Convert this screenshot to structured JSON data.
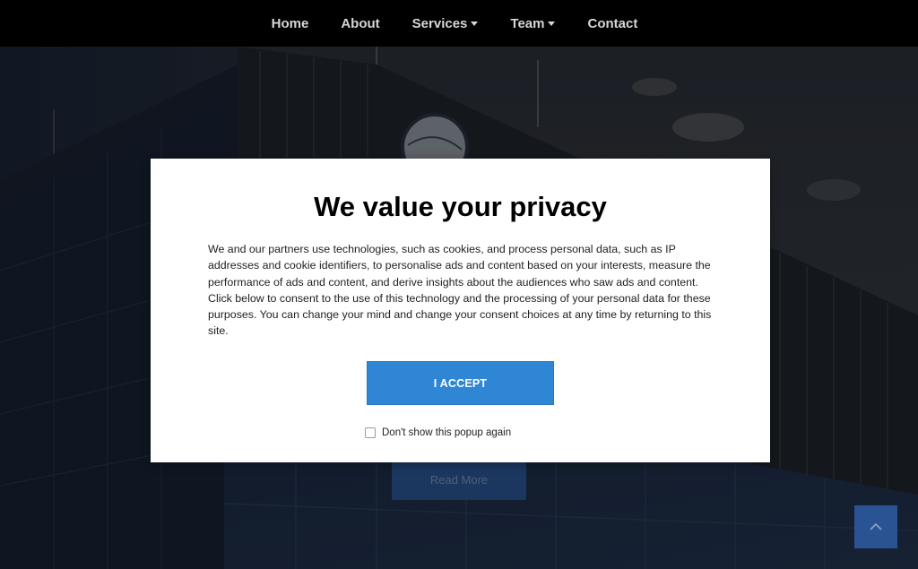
{
  "nav": {
    "items": [
      {
        "label": "Home",
        "has_dropdown": false
      },
      {
        "label": "About",
        "has_dropdown": false
      },
      {
        "label": "Services",
        "has_dropdown": true
      },
      {
        "label": "Team",
        "has_dropdown": true
      },
      {
        "label": "Contact",
        "has_dropdown": false
      }
    ]
  },
  "hero": {
    "read_more_label": "Read More",
    "scroll_top_icon": "chevron-up-icon"
  },
  "consent": {
    "title": "We value your privacy",
    "body": "We and our partners use technologies, such as cookies, and process personal data, such as IP addresses and cookie identifiers, to personalise ads and content based on your interests, measure the performance of ads and content, and derive insights about the audiences who saw ads and content. Click below to consent to the use of this technology and the processing of your personal data for these purposes. You can change your mind and change your consent choices at any time by returning to this site.",
    "accept_label": "I ACCEPT",
    "dont_show_label": "Don't show this popup again",
    "dont_show_checked": false
  },
  "colors": {
    "nav_bg": "#000000",
    "accent": "#2f86d5",
    "read_more_bg": "#2a5594",
    "scroll_top_bg": "#2a5394"
  }
}
